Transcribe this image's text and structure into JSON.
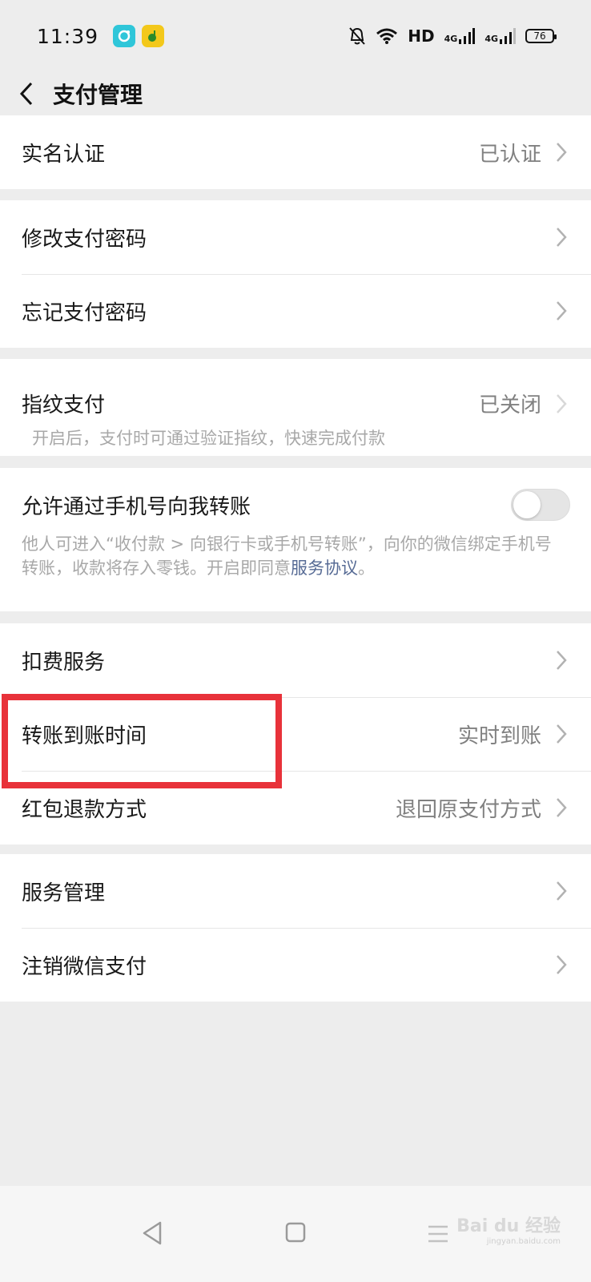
{
  "status": {
    "time": "11:39",
    "hd": "HD",
    "net1": "4G",
    "net2": "4G",
    "battery": "76"
  },
  "nav": {
    "title": "支付管理"
  },
  "sections": {
    "realname": {
      "label": "实名认证",
      "value": "已认证"
    },
    "change_pwd": {
      "label": "修改支付密码"
    },
    "forgot_pwd": {
      "label": "忘记支付密码"
    },
    "fingerprint": {
      "label": "指纹支付",
      "value": "已关闭",
      "desc": "开启后，支付时可通过验证指纹，快速完成付款"
    },
    "phone_transfer": {
      "label": "允许通过手机号向我转账",
      "desc": "他人可进入“收付款 > 向银行卡或手机号转账”，向你的微信绑定手机号转账，收款将存入零钱。开启即同意",
      "link": "服务协议",
      "desc_end": "。",
      "enabled": false
    },
    "deduction": {
      "label": "扣费服务"
    },
    "transfer_time": {
      "label": "转账到账时间",
      "value": "实时到账"
    },
    "redpacket_refund": {
      "label": "红包退款方式",
      "value": "退回原支付方式"
    },
    "service_mgmt": {
      "label": "服务管理"
    },
    "cancel_pay": {
      "label": "注销微信支付"
    }
  },
  "watermark": {
    "brand": "Bai du 经验",
    "url": "jingyan.baidu.com"
  },
  "colors": {
    "highlight": "#e8323a",
    "link": "#576b95",
    "background": "#ededed"
  }
}
